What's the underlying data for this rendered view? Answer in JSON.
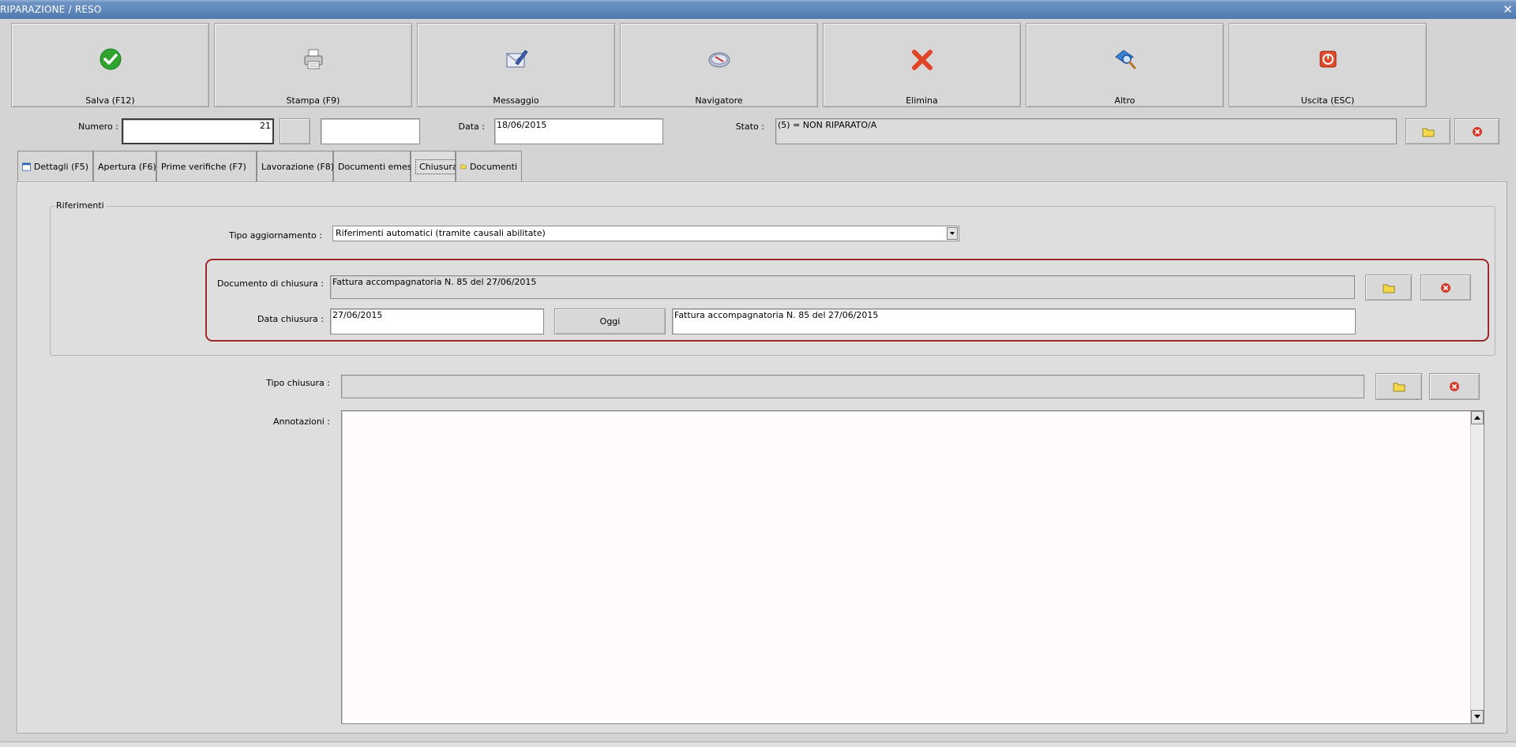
{
  "window": {
    "title": "RIPARAZIONE / RESO",
    "close_glyph": "✕"
  },
  "toolbar": [
    {
      "label": "Salva (F12)",
      "icon": "check-icon"
    },
    {
      "label": "Stampa (F9)",
      "icon": "printer-icon"
    },
    {
      "label": "Messaggio",
      "icon": "envelope-pen-icon"
    },
    {
      "label": "Navigatore",
      "icon": "compass-icon"
    },
    {
      "label": "Elimina",
      "icon": "delete-x-icon"
    },
    {
      "label": "Altro",
      "icon": "magnifier-icon"
    },
    {
      "label": "Uscita (ESC)",
      "icon": "power-icon"
    }
  ],
  "header": {
    "numero_label": "Numero :",
    "numero_value": "21",
    "extra_value": "",
    "data_label": "Data :",
    "data_value": "18/06/2015",
    "stato_label": "Stato :",
    "stato_value": "(5) = NON RIPARATO/A"
  },
  "tabs": [
    {
      "label": "Dettagli (F5)",
      "icon": "window-icon",
      "active": false
    },
    {
      "label": "Apertura (F6)",
      "active": false
    },
    {
      "label": "Prime verifiche (F7)",
      "active": false
    },
    {
      "label": "Lavorazione (F8)",
      "active": false
    },
    {
      "label": "Documenti emessi",
      "active": false
    },
    {
      "label": "Chiusura",
      "active": true
    },
    {
      "label": "Documenti",
      "icon": "folder-icon",
      "active": false
    }
  ],
  "riferimenti": {
    "legend": "Riferimenti",
    "tipo_aggiornamento_label": "Tipo aggiornamento :",
    "tipo_aggiornamento_value": "Riferimenti automatici (tramite causali abilitate)",
    "documento_label": "Documento di chiusura :",
    "documento_value": "Fattura accompagnatoria N. 85 del 27/06/2015",
    "data_chiusura_label": "Data chiusura :",
    "data_chiusura_value": "27/06/2015",
    "oggi_label": "Oggi",
    "descrizione_value": "Fattura accompagnatoria N. 85 del 27/06/2015"
  },
  "chiusura": {
    "tipo_chiusura_label": "Tipo chiusura :",
    "tipo_chiusura_value": "",
    "annotazioni_label": "Annotazioni :",
    "annotazioni_value": ""
  },
  "colors": {
    "accent_border": "#9c2a2a",
    "titlebar": "#5b84b9"
  }
}
